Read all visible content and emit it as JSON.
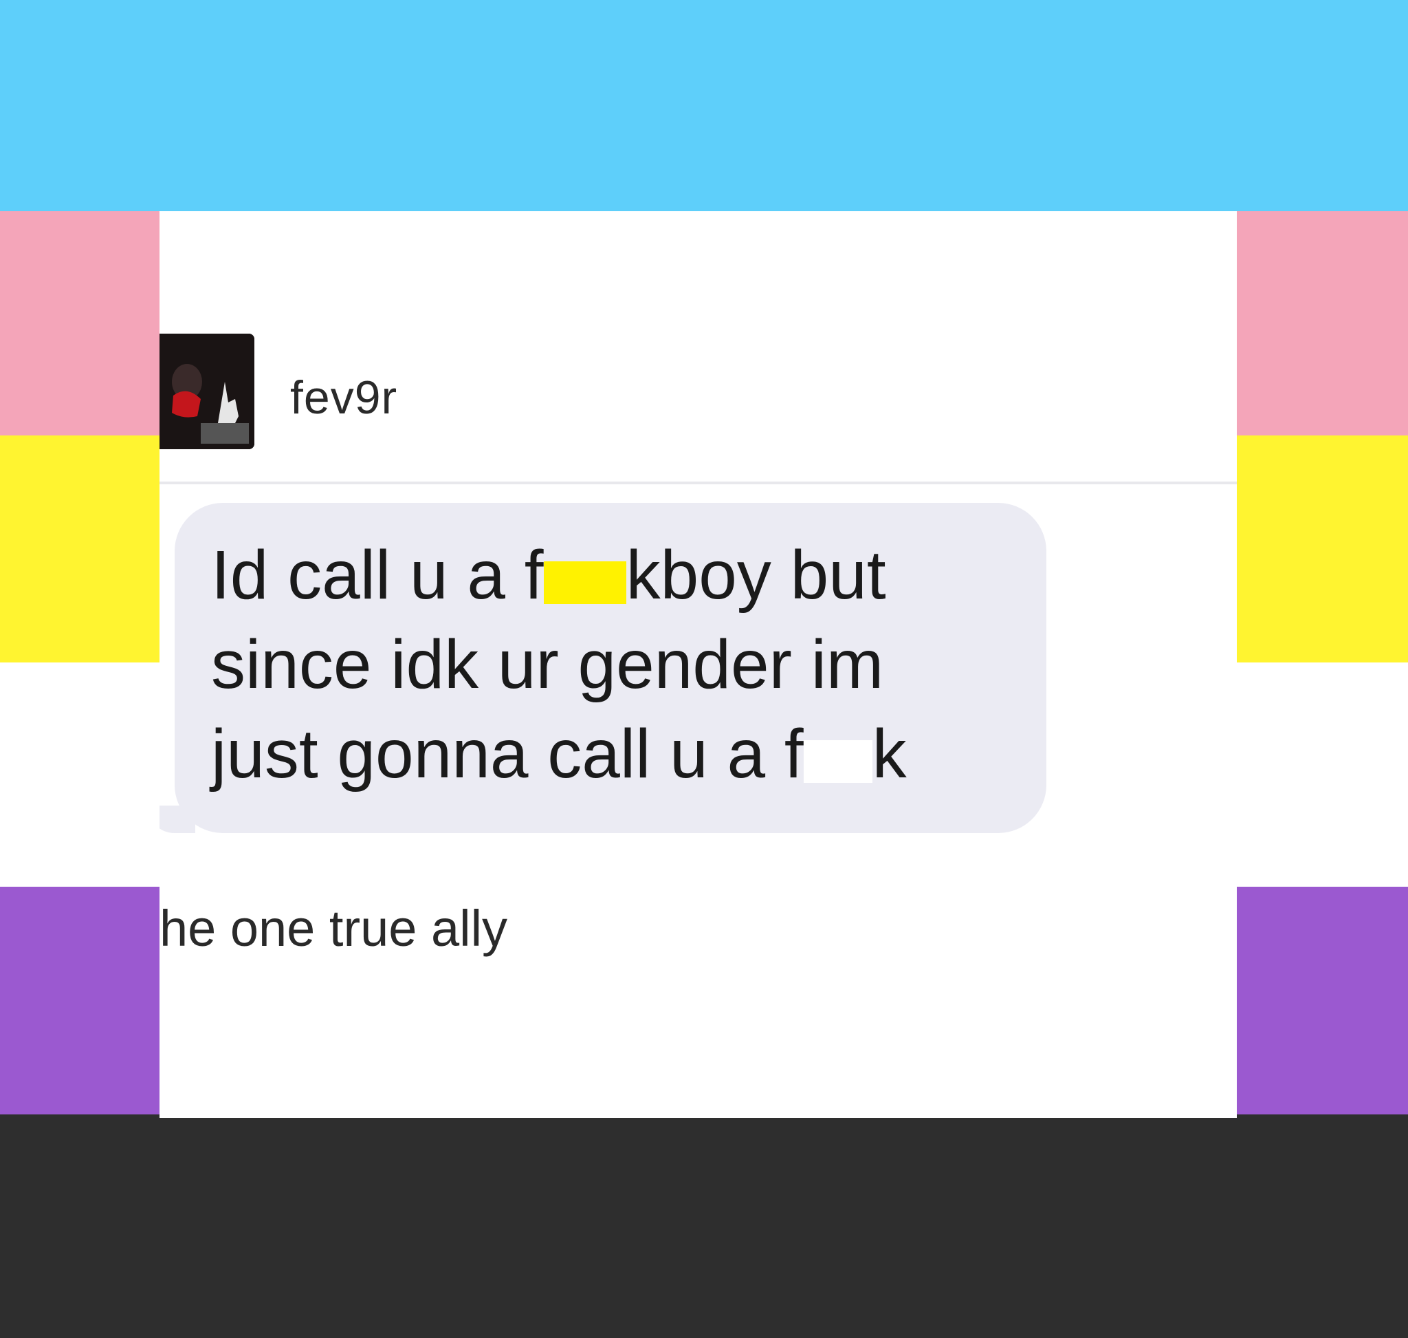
{
  "flag": {
    "colors": [
      "#5ecffa",
      "#f4a5b9",
      "#fff430",
      "#ffffff",
      "#9b59d0",
      "#2e2e2e"
    ]
  },
  "post": {
    "username": "fev9r",
    "avatar_icon": "user-avatar-photo",
    "message": {
      "line1_before": "Id call u a f",
      "line1_after": "kboy but",
      "line2": "since idk ur gender im",
      "line3_before": "just gonna call u a f",
      "line3_after": "k"
    },
    "caption": "he one true ally"
  }
}
